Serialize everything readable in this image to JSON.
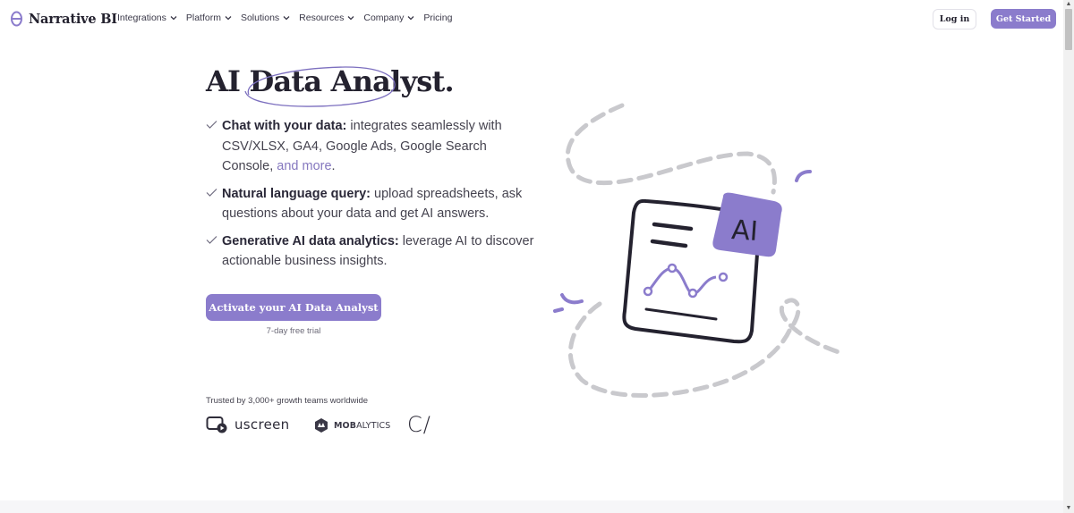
{
  "brand": {
    "name": "Narrative BI",
    "accent": "#8b7ccc"
  },
  "nav": {
    "items": [
      {
        "label": "Integrations",
        "has_dropdown": true
      },
      {
        "label": "Platform",
        "has_dropdown": true
      },
      {
        "label": "Solutions",
        "has_dropdown": true
      },
      {
        "label": "Resources",
        "has_dropdown": true
      },
      {
        "label": "Company",
        "has_dropdown": true
      },
      {
        "label": "Pricing",
        "has_dropdown": false
      }
    ],
    "login_label": "Log in",
    "get_started_label": "Get Started"
  },
  "hero": {
    "title": "AI Data Analyst.",
    "features": [
      {
        "bold": "Chat with your data:",
        "text": " integrates seamlessly with CSV/XLSX, GA4, Google Ads, Google Search Console, ",
        "link": "and more",
        "after": "."
      },
      {
        "bold": "Natural language query:",
        "text": " upload spreadsheets, ask questions about your data and get AI answers."
      },
      {
        "bold": "Generative AI data analytics:",
        "text": " leverage AI to discover actionable business insights."
      }
    ],
    "cta_label": "Activate your AI Data Analyst",
    "cta_note": "7-day free trial"
  },
  "trusted": {
    "label": "Trusted by 3,000+ growth teams worldwide",
    "logos": [
      {
        "name": "uscreen",
        "text": "uscreen"
      },
      {
        "name": "mobalytics",
        "text_bold": "MOB",
        "text": "ALYTICS"
      },
      {
        "name": "c-slash",
        "text": "C/"
      }
    ]
  },
  "illustration": {
    "badge_text": "AI",
    "icon": "ai-report-card-icon"
  }
}
